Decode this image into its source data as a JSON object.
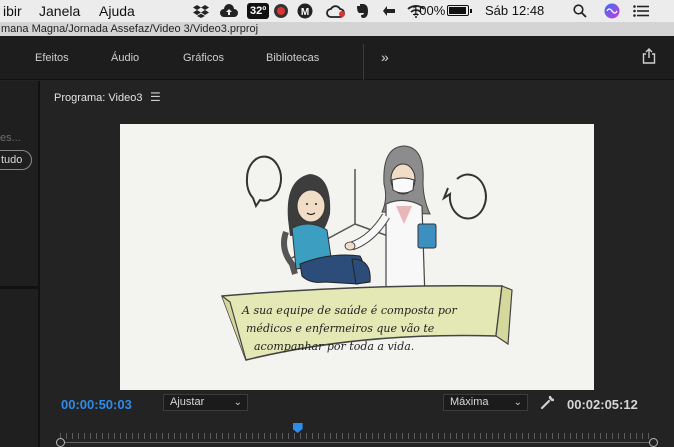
{
  "menubar": {
    "items": [
      "ibir",
      "Janela",
      "Ajuda"
    ],
    "temperature": "32º",
    "battery_percent": "100%",
    "battery_level": 1.0,
    "clock": "Sáb 12:48"
  },
  "path": "mana Magna/Jornada Assefaz/Video 3/Video3.prproj",
  "workspace_tabs": [
    "Efeitos",
    "Áudio",
    "Gráficos",
    "Bibliotecas"
  ],
  "left_panel": {
    "search_placeholder": "es...",
    "filter_button": "tudo"
  },
  "monitor": {
    "title": "Programa: Video3",
    "caption_lines": [
      "A sua equipe de saúde é composta por",
      "médicos e enfermeiros que vão te",
      "acompanhar por toda a vida."
    ],
    "current_timecode": "00:00:50:03",
    "duration_timecode": "00:02:05:12",
    "fit_select": "Ajustar",
    "quality_select": "Máxima",
    "playhead_fraction": 0.4
  },
  "colors": {
    "accent": "#2d8ceb",
    "panel": "#232323",
    "banner": "#e4e8b4"
  }
}
